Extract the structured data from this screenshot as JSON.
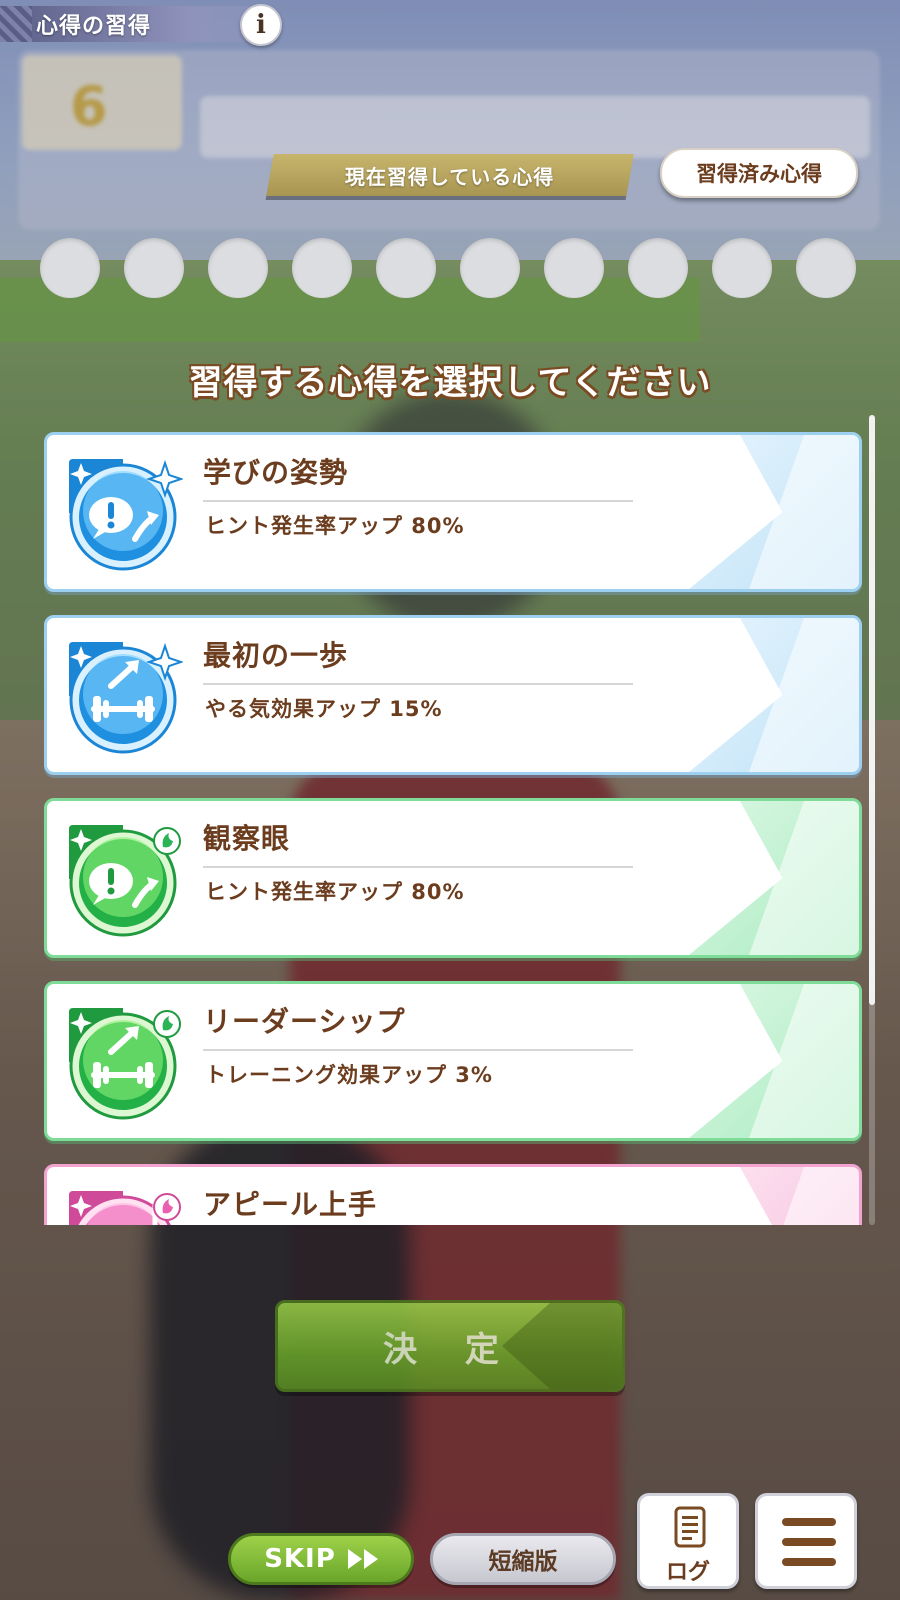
{
  "header": {
    "title": "心得の習得",
    "info_label": "i"
  },
  "tabs": {
    "current": "現在習得している心得",
    "learned": "習得済み心得"
  },
  "slots_count": 10,
  "background": {
    "turn_number": "6"
  },
  "instruction": "習得する心得を選択してください",
  "skills": [
    {
      "title": "学びの姿勢",
      "description": "ヒント発生率アップ 80%",
      "color": "blue",
      "icon": "hint-up-icon"
    },
    {
      "title": "最初の一歩",
      "description": "やる気効果アップ 15%",
      "color": "blue",
      "icon": "training-up-icon"
    },
    {
      "title": "観察眼",
      "description": "ヒント発生率アップ 80%",
      "color": "green",
      "icon": "hint-up-icon"
    },
    {
      "title": "リーダーシップ",
      "description": "トレーニング効果アップ 3%",
      "color": "green",
      "icon": "training-up-icon"
    },
    {
      "title": "アピール上手",
      "description": "",
      "color": "pink",
      "icon": "appeal-icon"
    }
  ],
  "buttons": {
    "decide": "決 定",
    "skip": "SKIP",
    "short": "短縮版",
    "log": "ログ"
  },
  "colors": {
    "text_brown": "#6b3d1e",
    "blue_border": "#9dd0f0",
    "green_border": "#7fdc98",
    "pink_border": "#f3a3cf",
    "decide_green": "#6aa62a"
  }
}
